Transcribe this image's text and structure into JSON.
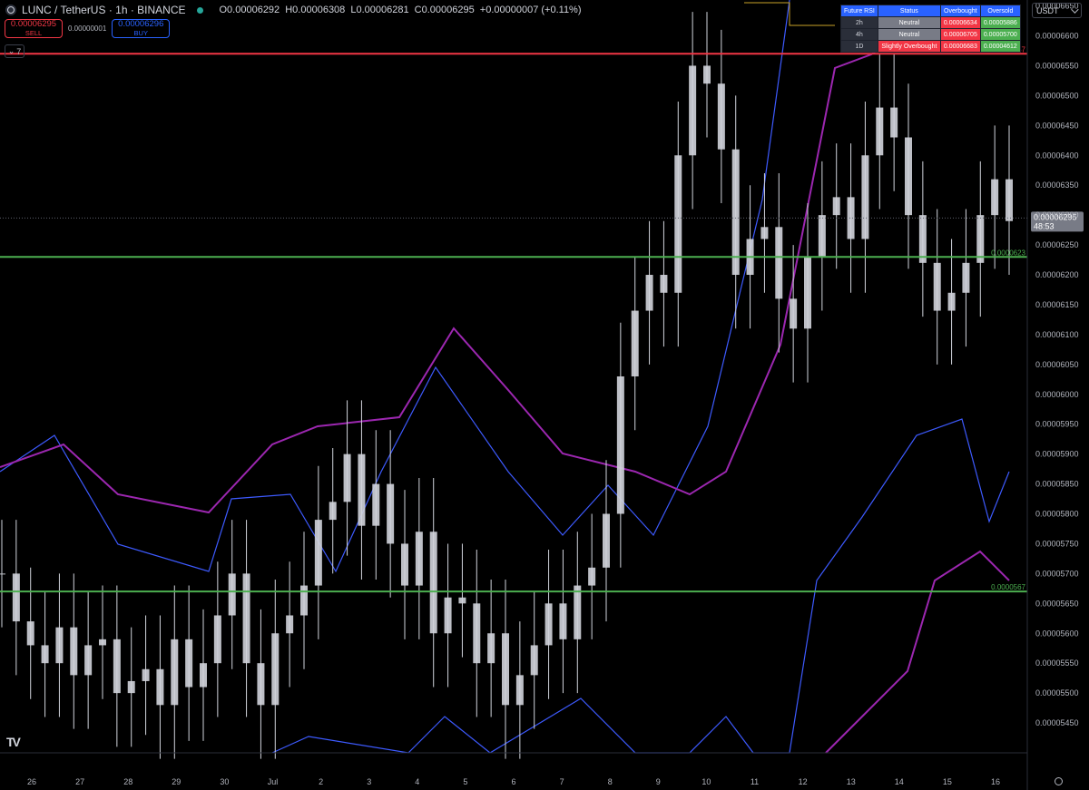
{
  "header": {
    "symbol": "LUNC / TetherUS · 1h · BINANCE",
    "ohlc": {
      "o": "O0.00006292",
      "h": "H0.00006308",
      "l": "L0.00006281",
      "c": "C0.00006295",
      "change": "+0.00000007 (+0.11%)"
    },
    "status_color": "#26a69a"
  },
  "trade": {
    "sell_price": "0.00006295",
    "sell_label": "SELL",
    "spread": "0.00000001",
    "buy_price": "0.00006296",
    "buy_label": "BUY"
  },
  "indicators_collapsed": {
    "count": "7"
  },
  "currency": "USDT",
  "rsi_table": {
    "headers": [
      "Future RSI",
      "Status",
      "Overbought",
      "Oversold"
    ],
    "rows": [
      {
        "tf": "2h",
        "status": "Neutral",
        "overbought": "0.00006634",
        "oversold": "0.00005886"
      },
      {
        "tf": "4h",
        "status": "Neutral",
        "overbought": "0.00006705",
        "oversold": "0.00005700"
      },
      {
        "tf": "1D",
        "status": "Slightly Overbought",
        "overbought": "0.00006683",
        "oversold": "0.00004612"
      }
    ]
  },
  "chart_data": {
    "type": "candlestick",
    "y_axis": {
      "min": 5.4e-05,
      "max": 6.66e-05,
      "ticks": [
        "0.00006650",
        "0.00006600",
        "0.00006550",
        "0.00006500",
        "0.00006450",
        "0.00006400",
        "0.00006350",
        "0.00006300",
        "0.00006250",
        "0.00006200",
        "0.00006150",
        "0.00006100",
        "0.00006050",
        "0.00006000",
        "0.00005950",
        "0.00005900",
        "0.00005850",
        "0.00005800",
        "0.00005750",
        "0.00005700",
        "0.00005650",
        "0.00005600",
        "0.00005550",
        "0.00005500",
        "0.00005450"
      ]
    },
    "x_axis": {
      "ticks": [
        "26",
        "27",
        "28",
        "29",
        "30",
        "Jul",
        "2",
        "3",
        "4",
        "5",
        "6",
        "7",
        "8",
        "9",
        "10",
        "11",
        "12",
        "13",
        "14",
        "15",
        "16"
      ]
    },
    "horizontal_lines": [
      {
        "value": 6.57e-05,
        "color": "#f23645",
        "label": "0.0000657"
      },
      {
        "value": 6.23e-05,
        "color": "#4caf50",
        "label": "0.0000623"
      },
      {
        "value": 5.67e-05,
        "color": "#4caf50",
        "label": "0.0000567"
      }
    ],
    "last_price": {
      "value": 6.295e-05,
      "label": "0.00006295",
      "countdown": "48:53"
    },
    "series": [
      {
        "type": "candles",
        "color": "#d1d4dc",
        "closes": [
          5.7e-05,
          5.62e-05,
          5.58e-05,
          5.55e-05,
          5.61e-05,
          5.53e-05,
          5.58e-05,
          5.59e-05,
          5.5e-05,
          5.52e-05,
          5.54e-05,
          5.48e-05,
          5.59e-05,
          5.51e-05,
          5.55e-05,
          5.63e-05,
          5.7e-05,
          5.55e-05,
          5.48e-05,
          5.6e-05,
          5.63e-05,
          5.68e-05,
          5.79e-05,
          5.82e-05,
          5.9e-05,
          5.78e-05,
          5.85e-05,
          5.75e-05,
          5.68e-05,
          5.77e-05,
          5.6e-05,
          5.66e-05,
          5.65e-05,
          5.55e-05,
          5.6e-05,
          5.48e-05,
          5.53e-05,
          5.58e-05,
          5.65e-05,
          5.59e-05,
          5.68e-05,
          5.71e-05,
          5.8e-05,
          6.03e-05,
          6.14e-05,
          6.2e-05,
          6.17e-05,
          6.4e-05,
          6.55e-05,
          6.52e-05,
          6.41e-05,
          6.2e-05,
          6.26e-05,
          6.28e-05,
          6.16e-05,
          6.11e-05,
          6.23e-05,
          6.3e-05,
          6.33e-05,
          6.26e-05,
          6.4e-05,
          6.48e-05,
          6.43e-05,
          6.3e-05,
          6.22e-05,
          6.14e-05,
          6.17e-05,
          6.22e-05,
          6.3e-05,
          6.36e-05,
          6.29e-05
        ]
      },
      {
        "type": "line",
        "color": "#3d5afe"
      },
      {
        "type": "line",
        "color": "#9c27b0"
      }
    ]
  }
}
